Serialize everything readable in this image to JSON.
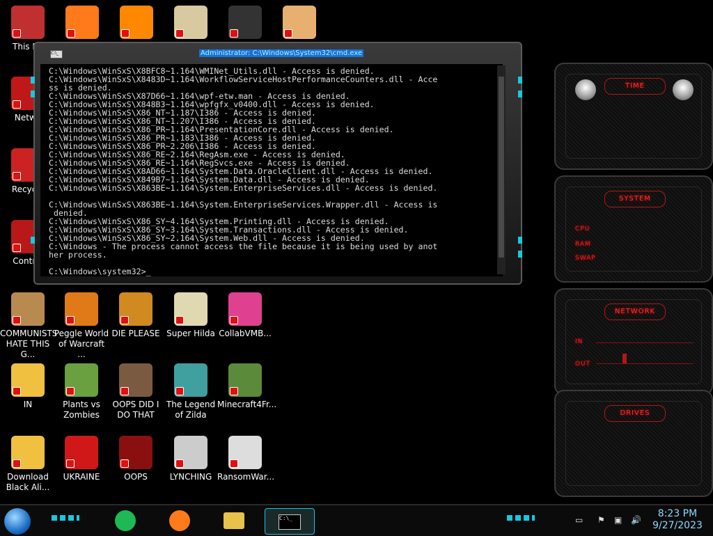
{
  "desktop_icons": [
    {
      "id": "this-pc",
      "label": "This PC",
      "color": "#c03030"
    },
    {
      "id": "firefox-1",
      "label": "",
      "color": "#ff7a1a"
    },
    {
      "id": "vlc",
      "label": "",
      "color": "#ff8800"
    },
    {
      "id": "hxd",
      "label": "",
      "color": "#d9c9a0"
    },
    {
      "id": "app-dark",
      "label": "",
      "color": "#333333"
    },
    {
      "id": "user-app",
      "label": "",
      "color": "#e8b070"
    },
    {
      "id": "network",
      "label": "Netwo",
      "color": "#c01818"
    },
    {
      "id": "recycle",
      "label": "Recycle",
      "color": "#cc2222"
    },
    {
      "id": "control",
      "label": "Control",
      "color": "#b81818"
    },
    {
      "id": "communists",
      "label": "COMMUNISTS HATE THIS G...",
      "color": "#b88a50"
    },
    {
      "id": "peggle",
      "label": "Peggle World of Warcraft ...",
      "color": "#e07a18"
    },
    {
      "id": "die-please",
      "label": "DIE PLEASE",
      "color": "#d08a20"
    },
    {
      "id": "super-hilda",
      "label": "Super Hilda",
      "color": "#e0d8b0"
    },
    {
      "id": "collabvmb",
      "label": "CollabVMB...",
      "color": "#e04090"
    },
    {
      "id": "star-butterfly",
      "label": "IN",
      "color": "#f0c040"
    },
    {
      "id": "plants-zombies",
      "label": "Plants vs Zombies",
      "color": "#6aa040"
    },
    {
      "id": "oops-did-i",
      "label": "OOPS DID I DO THAT",
      "color": "#7a5a40"
    },
    {
      "id": "legend-zilda",
      "label": "The Legend of Zilda",
      "color": "#40a0a0"
    },
    {
      "id": "minecraft",
      "label": "Minecraft4Fr...",
      "color": "#5a8a3a"
    },
    {
      "id": "download-black",
      "label": "Download Black Ali...",
      "color": "#f0c040"
    },
    {
      "id": "ukraine",
      "label": "UKRAINE",
      "color": "#d01818"
    },
    {
      "id": "oops",
      "label": "OOPS",
      "color": "#8a1010"
    },
    {
      "id": "lynching",
      "label": "LYNCHING",
      "color": "#cccccc"
    },
    {
      "id": "ransomware",
      "label": "RansomWar...",
      "color": "#dddddd"
    }
  ],
  "cmd": {
    "title": "Administrator: C:\\Windows\\System32\\cmd.exe",
    "icon_text": "C:\\_",
    "lines": [
      "C:\\Windows\\WinSxS\\X8BFC8~1.164\\WMINet_Utils.dll - Access is denied.",
      "C:\\Windows\\WinSxS\\X8483D~1.164\\WorkflowServiceHostPerformanceCounters.dll - Acce",
      "ss is denied.",
      "C:\\Windows\\WinSxS\\X87D66~1.164\\wpf-etw.man - Access is denied.",
      "C:\\Windows\\WinSxS\\X848B3~1.164\\wpfgfx_v0400.dll - Access is denied.",
      "C:\\Windows\\WinSxS\\X86_NT~1.187\\I386 - Access is denied.",
      "C:\\Windows\\WinSxS\\X86_NT~1.207\\I386 - Access is denied.",
      "C:\\Windows\\WinSxS\\X86_PR~1.164\\PresentationCore.dll - Access is denied.",
      "C:\\Windows\\WinSxS\\X86_PR~1.183\\I386 - Access is denied.",
      "C:\\Windows\\WinSxS\\X86_PR~2.206\\I386 - Access is denied.",
      "C:\\Windows\\WinSxS\\X86_RE~2.164\\RegAsm.exe - Access is denied.",
      "C:\\Windows\\WinSxS\\X86_RE~1.164\\RegSvcs.exe - Access is denied.",
      "C:\\Windows\\WinSxS\\X8AD66~1.164\\System.Data.OracleClient.dll - Access is denied.",
      "C:\\Windows\\WinSxS\\X849B7~1.164\\System.Data.dll - Access is denied.",
      "C:\\Windows\\WinSxS\\X863BE~1.164\\System.EnterpriseServices.dll - Access is denied.",
      "",
      "C:\\Windows\\WinSxS\\X863BE~1.164\\System.EnterpriseServices.Wrapper.dll - Access is",
      " denied.",
      "C:\\Windows\\WinSxS\\X86_SY~4.164\\System.Printing.dll - Access is denied.",
      "C:\\Windows\\WinSxS\\X86_SY~3.164\\System.Transactions.dll - Access is denied.",
      "C:\\Windows\\WinSxS\\X86_SY~2.164\\System.Web.dll - Access is denied.",
      "C:\\Windows - The process cannot access the file because it is being used by anot",
      "her process.",
      "",
      "C:\\Windows\\system32>_"
    ]
  },
  "gadgets": {
    "time": {
      "title": "TIME"
    },
    "system": {
      "title": "SYSTEM",
      "labels": [
        "CPU",
        "RAM",
        "SWAP"
      ]
    },
    "network": {
      "title": "NETWORK",
      "labels": [
        "IN",
        "OUT"
      ]
    },
    "drives": {
      "title": "DRIVES"
    }
  },
  "taskbar": {
    "pinned": [
      {
        "id": "spotify",
        "color": "#1db954"
      },
      {
        "id": "firefox",
        "color": "#ff7a1a"
      },
      {
        "id": "explorer",
        "color": "#e8c24a"
      },
      {
        "id": "cmd",
        "color": "#dddddd"
      }
    ],
    "cmd_icon_text": "C:\\_",
    "time": "8:23 PM",
    "date": "9/27/2023",
    "accent": "#18c8e0"
  }
}
